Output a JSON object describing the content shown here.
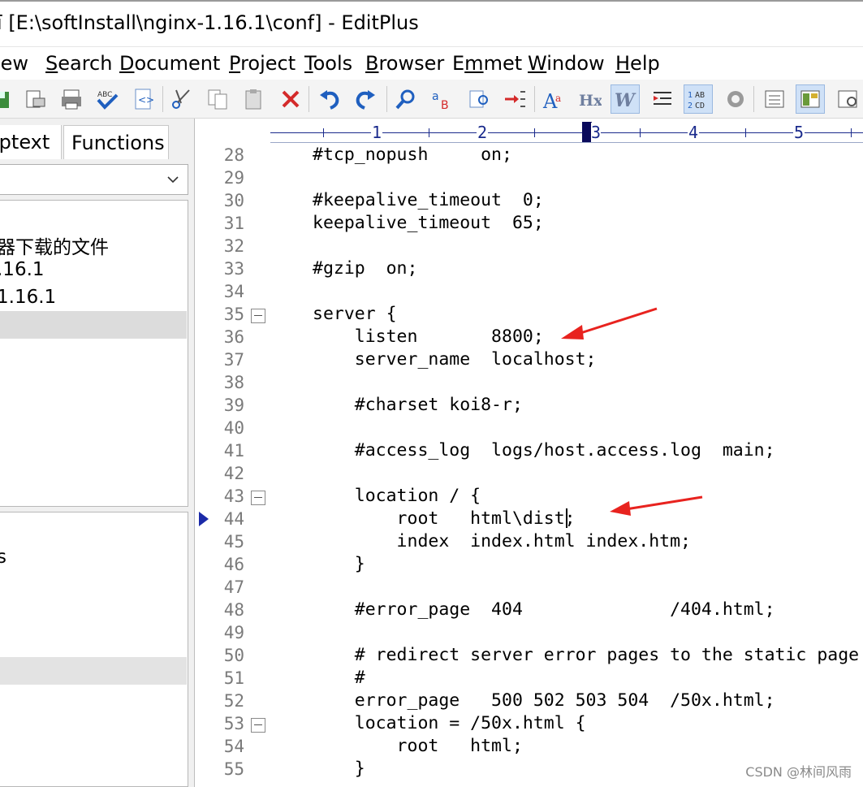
{
  "window": {
    "title": "[E:\\softInstall\\nginx-1.16.1\\conf] - EditPlus",
    "title_prefix_glyph": "ī"
  },
  "menu": {
    "items": [
      {
        "pre": "",
        "u": "V",
        "post": "iew",
        "shown": "iew"
      },
      {
        "pre": "",
        "u": "S",
        "post": "earch"
      },
      {
        "pre": "",
        "u": "D",
        "post": "ocument"
      },
      {
        "pre": "",
        "u": "P",
        "post": "roject"
      },
      {
        "pre": "",
        "u": "T",
        "post": "ools"
      },
      {
        "pre": "",
        "u": "B",
        "post": "rowser"
      },
      {
        "pre": "E",
        "u": "m",
        "post": "met"
      },
      {
        "pre": "",
        "u": "W",
        "post": "indow"
      },
      {
        "pre": "",
        "u": "H",
        "post": "elp"
      }
    ]
  },
  "toolbar": {
    "icons": [
      "save-icon",
      "print-preview-icon",
      "print-icon",
      "spell-check-icon",
      "browser-preview-icon",
      "cut-icon",
      "copy-icon",
      "paste-icon",
      "delete-icon",
      "undo-icon",
      "redo-icon",
      "find-icon",
      "replace-icon",
      "find-in-files-icon",
      "goto-icon",
      "font-icon",
      "html-tag-icon",
      "word-wrap-icon",
      "indent-icon",
      "line-numbers-icon",
      "settings-icon",
      "output-window-icon",
      "directory-window-icon",
      "cliptext-window-icon"
    ],
    "colors": {
      "accent": "#1f5fbf",
      "red": "#d42a2a",
      "active_bg": "#cfe1f7"
    }
  },
  "left_pane": {
    "tabs": [
      "iptext",
      "Functions"
    ],
    "tree_nodes": [
      "器下载的文件",
      ".16.1",
      "1.16.1"
    ],
    "file_items": [
      "s"
    ]
  },
  "editor": {
    "ruler_numbers": [
      "1",
      "2",
      "3",
      "4",
      "5"
    ],
    "lines": [
      {
        "n": "28",
        "text": "#tcp_nopush     on;"
      },
      {
        "n": "29",
        "text": ""
      },
      {
        "n": "30",
        "text": "#keepalive_timeout  0;"
      },
      {
        "n": "31",
        "text": "keepalive_timeout  65;"
      },
      {
        "n": "32",
        "text": ""
      },
      {
        "n": "33",
        "text": "#gzip  on;"
      },
      {
        "n": "34",
        "text": ""
      },
      {
        "n": "35",
        "text": "server {",
        "fold": true
      },
      {
        "n": "36",
        "text": "    listen       8800;"
      },
      {
        "n": "37",
        "text": "    server_name  localhost;"
      },
      {
        "n": "38",
        "text": ""
      },
      {
        "n": "39",
        "text": "    #charset koi8-r;"
      },
      {
        "n": "40",
        "text": ""
      },
      {
        "n": "41",
        "text": "    #access_log  logs/host.access.log  main;"
      },
      {
        "n": "42",
        "text": ""
      },
      {
        "n": "43",
        "text": "    location / {",
        "fold": true
      },
      {
        "n": "44",
        "text": "        root   html\\dist",
        "after_caret": ";",
        "current": true
      },
      {
        "n": "45",
        "text": "        index  index.html index.htm;"
      },
      {
        "n": "46",
        "text": "    }"
      },
      {
        "n": "47",
        "text": ""
      },
      {
        "n": "48",
        "text": "    #error_page  404              /404.html;"
      },
      {
        "n": "49",
        "text": ""
      },
      {
        "n": "50",
        "text": "    # redirect server error pages to the static page"
      },
      {
        "n": "51",
        "text": "    #"
      },
      {
        "n": "52",
        "text": "    error_page   500 502 503 504  /50x.html;"
      },
      {
        "n": "53",
        "text": "    location = /50x.html {",
        "fold": true
      },
      {
        "n": "54",
        "text": "        root   html;"
      },
      {
        "n": "55",
        "text": "    }"
      }
    ]
  },
  "watermark": "CSDN @林间风雨",
  "annotation_color": "#e8231f"
}
